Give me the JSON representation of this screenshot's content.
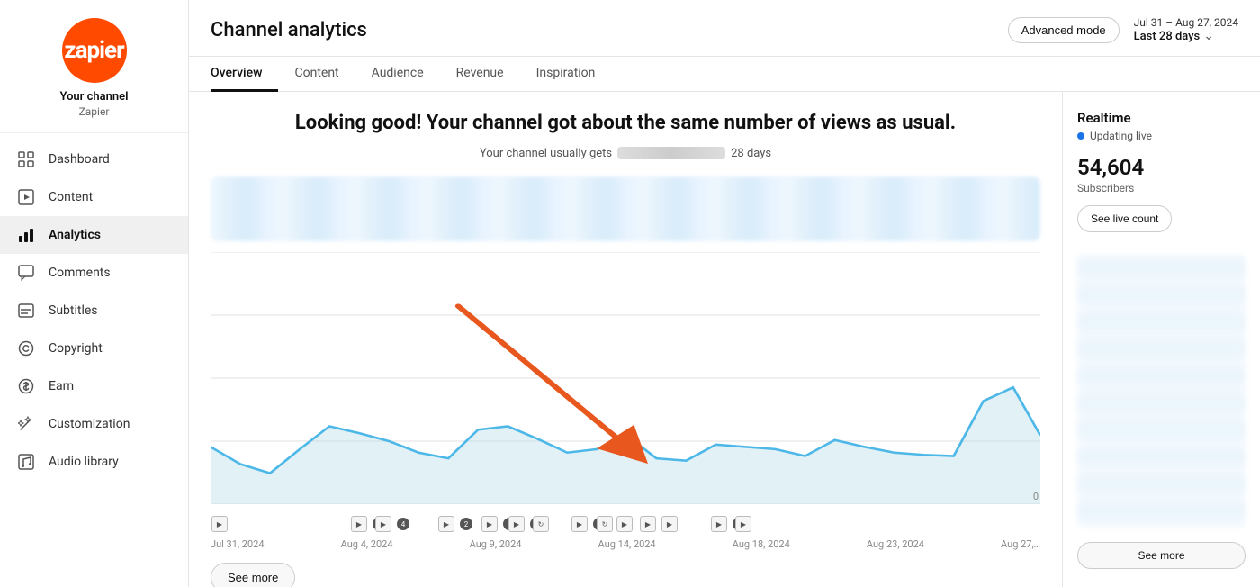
{
  "sidebar": {
    "logo_text": "zapier",
    "channel_name": "Your channel",
    "channel_sub": "Zapier",
    "nav_items": [
      {
        "id": "dashboard",
        "label": "Dashboard",
        "icon": "grid"
      },
      {
        "id": "content",
        "label": "Content",
        "icon": "play-square"
      },
      {
        "id": "analytics",
        "label": "Analytics",
        "icon": "bar-chart",
        "active": true
      },
      {
        "id": "comments",
        "label": "Comments",
        "icon": "comment"
      },
      {
        "id": "subtitles",
        "label": "Subtitles",
        "icon": "subtitles"
      },
      {
        "id": "copyright",
        "label": "Copyright",
        "icon": "copyright"
      },
      {
        "id": "earn",
        "label": "Earn",
        "icon": "dollar"
      },
      {
        "id": "customization",
        "label": "Customization",
        "icon": "magic"
      },
      {
        "id": "audio-library",
        "label": "Audio library",
        "icon": "music"
      }
    ]
  },
  "header": {
    "page_title": "Channel analytics",
    "advanced_mode_label": "Advanced mode",
    "date_range_top": "Jul 31 – Aug 27, 2024",
    "date_range_bottom": "Last 28 days"
  },
  "tabs": [
    {
      "id": "overview",
      "label": "Overview",
      "active": true
    },
    {
      "id": "content",
      "label": "Content"
    },
    {
      "id": "audience",
      "label": "Audience"
    },
    {
      "id": "revenue",
      "label": "Revenue"
    },
    {
      "id": "inspiration",
      "label": "Inspiration"
    }
  ],
  "main": {
    "headline": "Looking good! Your channel got about the same number of views as usual.",
    "sub_text_prefix": "Your channel usually gets",
    "sub_text_suffix": "28 days",
    "see_more_label": "See more"
  },
  "realtime": {
    "title": "Realtime",
    "updating_label": "Updating live",
    "subscribers_count": "54,604",
    "subscribers_label": "Subscribers",
    "see_live_count_label": "See live count",
    "see_more_label": "See more"
  },
  "chart": {
    "x_labels": [
      "Jul 31, 2024",
      "Aug 4, 2024",
      "Aug 9, 2024",
      "Aug 14, 2024",
      "Aug 18, 2024",
      "Aug 23, 2024",
      "Aug 27,…"
    ],
    "y_zero": "0",
    "data_points": [
      38,
      29,
      26,
      48,
      55,
      51,
      44,
      38,
      36,
      53,
      55,
      42,
      36,
      38,
      45,
      32,
      30,
      42,
      40,
      38,
      34,
      40,
      50,
      38,
      36,
      34,
      80,
      90
    ]
  }
}
